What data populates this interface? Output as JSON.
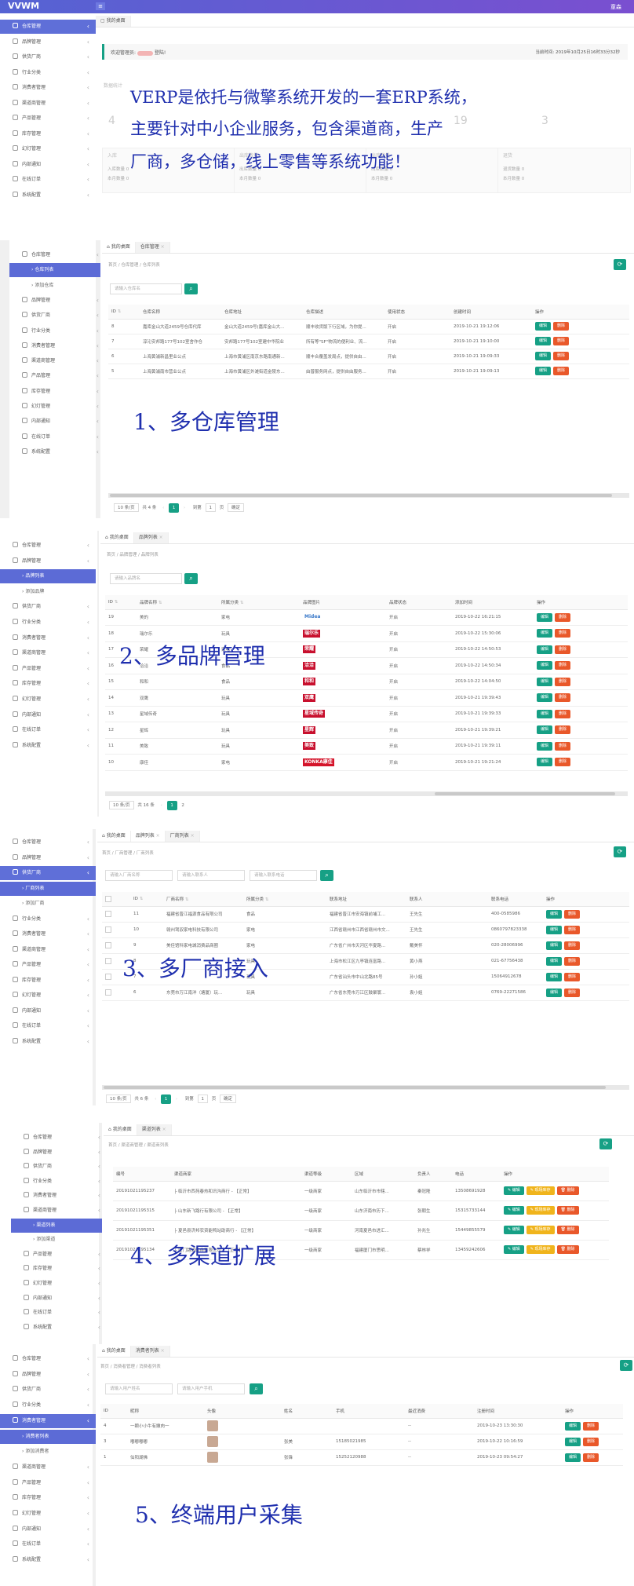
{
  "app": {
    "logo": "VVWM",
    "user": "童森"
  },
  "sidebar_icons": [
    "user-icon",
    "tag-icon",
    "factory-icon",
    "industry-icon",
    "consumer-icon",
    "channel-icon",
    "product-icon",
    "warehouse-icon",
    "slide-icon",
    "notice-icon",
    "order-icon",
    "gear-icon"
  ],
  "s1": {
    "sidebar": [
      "仓库管理",
      "品牌管理",
      "供货厂商",
      "行业分类",
      "消费者管理",
      "渠道商管理",
      "产品管理",
      "库存管理",
      "幻灯管理",
      "内部通知",
      "在线订单",
      "系统配置"
    ],
    "tab": "我的桌面",
    "welcome": "欢迎管理员: ",
    "welcome_suffix": " 登陆!",
    "time": "当前时间: 2019年10月25日16时33分32秒",
    "overlay": [
      "VERP是依托与微擎系统开发的一套ERP系统，",
      "主要针对中小企业服务，包含渠道商，生产",
      "厂商，多仓储，线上零售等系统功能！"
    ],
    "stat_numbers": [
      "4",
      "19",
      "3"
    ],
    "stat_label": "数据统计",
    "cards": [
      {
        "title": "入库",
        "lines": [
          "入库数量 0",
          "本月数量 0"
        ]
      },
      {
        "title": "出库数量",
        "lines": [
          "出库数量 0",
          "本月数量 0"
        ]
      },
      {
        "title": "出库数量",
        "lines": [
          "出库数量 0",
          "本月数量 0"
        ]
      },
      {
        "title": "退货",
        "lines": [
          "退货数量 0",
          "本月数量 0"
        ]
      }
    ]
  },
  "s2": {
    "sidebar": [
      "仓库管理",
      "仓库列表",
      "添加仓库",
      "品牌管理",
      "供货厂商",
      "行业分类",
      "消费者管理",
      "渠道商管理",
      "产品管理",
      "库存管理",
      "幻灯管理",
      "内部通知",
      "在线订单",
      "系统配置"
    ],
    "tabs": [
      "我的桌面",
      "仓库管理"
    ],
    "crumb": "首页  /  仓库管理  /  仓库列表",
    "search_placeholder": "请输入仓库名",
    "columns": [
      "ID",
      "仓库名称",
      "仓库地址",
      "仓库描述",
      "使用状态",
      "创建时间",
      "操作"
    ],
    "rows": [
      [
        "8",
        "嘉库金山大道2459号仓库代库",
        "金山大道2459号(嘉库金山大...",
        "顺丰收货版下行区域，为你提...",
        "开启",
        "2019-10-21 19:12:06"
      ],
      [
        "7",
        "淳沁安邦路177号102室舍作仓",
        "安邦路177号102室建中华院业",
        "所有等\"SF\"物流的便利业、流...",
        "开启",
        "2019-10-21 19:10:00"
      ],
      [
        "6",
        "上海黄浦新昌里业公点",
        "上海市黄浦区南京东路南通新...",
        "顺丰合覆盖发局点，提供自由...",
        "开启",
        "2019-10-21 19:09:33"
      ],
      [
        "5",
        "上海黄浦南市营业公点",
        "上海市黄浦区外滩街道金陵东...",
        "由普服务网点，提供自由服务...",
        "开启",
        "2019-10-21 19:09:13"
      ]
    ],
    "pager": {
      "size": "10 条/页",
      "total": "共 4 条",
      "page": "1",
      "goto": "到第",
      "page_input": "1",
      "unit": "页",
      "ok": "确定"
    },
    "overlay": "1、多仓库管理"
  },
  "s3": {
    "sidebar": [
      "仓库管理",
      "品牌管理",
      "品牌列表",
      "添加品牌",
      "供货厂商",
      "行业分类",
      "消费者管理",
      "渠道商管理",
      "产品管理",
      "库存管理",
      "幻灯管理",
      "内部通知",
      "在线订单",
      "系统配置"
    ],
    "tabs": [
      "我的桌面",
      "品牌列表"
    ],
    "crumb": "首页  /  品牌管理  /  品牌列表",
    "search_placeholder": "请输入品牌名",
    "columns": [
      "ID",
      "品牌名称",
      "所属分类",
      "品牌图片",
      "品牌状态",
      "添加时间",
      "操作"
    ],
    "rows": [
      [
        "19",
        "美的",
        "家电",
        "Midea",
        "开启",
        "2019-10-22 16:21:15"
      ],
      [
        "18",
        "瑞尔乐",
        "玩具",
        "瑞尔乐",
        "开启",
        "2019-10-22 15:30:06"
      ],
      [
        "17",
        "荣耀",
        "家电",
        "荣耀",
        "开启",
        "2019-10-22 14:50:53"
      ],
      [
        "16",
        "洽洽",
        "食品",
        "洽洽",
        "开启",
        "2019-10-22 14:50:34"
      ],
      [
        "15",
        "和和",
        "食品",
        "和和",
        "开启",
        "2019-10-22 14:04:50"
      ],
      [
        "14",
        "双鹰",
        "玩具",
        "双鹰",
        "开启",
        "2019-10-21 19:39:43"
      ],
      [
        "13",
        "星域传奇",
        "玩具",
        "星域传奇",
        "开启",
        "2019-10-21 19:39:33"
      ],
      [
        "12",
        "星辉",
        "玩具",
        "星辉",
        "开启",
        "2019-10-21 19:39:21"
      ],
      [
        "11",
        "美致",
        "玩具",
        "美致",
        "开启",
        "2019-10-21 19:39:11"
      ],
      [
        "10",
        "康佳",
        "家电",
        "KONKA康佳",
        "开启",
        "2019-10-21 19:21:24"
      ]
    ],
    "logo_colors": [
      "#3a79c9",
      "#c8102e",
      "#c8102e",
      "#c8102e",
      "#c8102e",
      "#c8102e",
      "#c8102e",
      "#c8102e",
      "#c8102e",
      "#d4142a"
    ],
    "pager": {
      "size": "10 条/页",
      "total": "共 16 条",
      "page": "1",
      "next": "2"
    },
    "overlay": "2、多品牌管理"
  },
  "s4": {
    "sidebar": [
      "仓库管理",
      "品牌管理",
      "供货厂商",
      "厂商列表",
      "添加厂商",
      "行业分类",
      "消费者管理",
      "渠道商管理",
      "产品管理",
      "库存管理",
      "幻灯管理",
      "内部通知",
      "在线订单",
      "系统配置"
    ],
    "tabs": [
      "我的桌面",
      "品牌列表",
      "厂商列表"
    ],
    "crumb": "首页  /  厂商管理  /  厂商列表",
    "search": [
      "请输入厂商名称",
      "请输入联系人",
      "请输入联系电话"
    ],
    "columns": [
      "",
      "ID",
      "厂商名称",
      "所属分类",
      "联系地址",
      "联系人",
      "联系电话",
      "操作"
    ],
    "rows": [
      [
        "",
        "11",
        "福建省晋江福源食品有限公司",
        "食品",
        "福建省晋江市安海镇前埔工...",
        "王先生",
        "400-0585986"
      ],
      [
        "",
        "10",
        "赣州驾驭家电科技有限公司",
        "家电",
        "江西省赣州市江西省赣州市文...",
        "王先生",
        "0860797823338"
      ],
      [
        "",
        "9",
        "美佳馆科家电城消费品商圈",
        "家电",
        "广东省广州市天河区华夏路...",
        "戴美怀",
        "020-28006996"
      ],
      [
        "",
        "8",
        "",
        "玩具",
        "上海市松江区九亭镇连富路...",
        "黄小燕",
        "021-67756438"
      ],
      [
        "",
        "7",
        "",
        "玩具",
        "广东省汕头市中山北路85号",
        "孙小姐",
        "15064912678"
      ],
      [
        "",
        "6",
        "东莞市万江南洋（塘厦）玩...",
        "玩具",
        "广东省东莞市万江区鼓聚寰...",
        "袁小姐",
        "0769-22271586"
      ]
    ],
    "pager": {
      "size": "10 条/页",
      "total": "共 6 条",
      "page": "1",
      "goto": "到第",
      "page_input": "1",
      "unit": "页",
      "ok": "确定"
    },
    "overlay": "3、多厂商接入"
  },
  "s5": {
    "sidebar": [
      "仓库管理",
      "品牌管理",
      "供货厂商",
      "行业分类",
      "消费者管理",
      "渠道商管理",
      "渠道列表",
      "添加渠道",
      "产品管理",
      "库存管理",
      "幻灯管理",
      "内部通知",
      "在线订单",
      "系统配置"
    ],
    "tabs": [
      "我的桌面",
      "渠道列表"
    ],
    "crumb": "首页  /  渠道商管理  /  渠道商列表",
    "columns": [
      "编号",
      "渠道商家",
      "渠道等级",
      "区域",
      "负责人",
      "电话",
      "操作"
    ],
    "rows": [
      [
        "20191021195237",
        "├ 临沂市西苑春热和讯沟商行 - 【正常】",
        "一级商家",
        "山东临沂市市辖...",
        "秦冠隆",
        "13508691928"
      ],
      [
        "20191021195315",
        "├ 山东新飞路行有限公司 - 【正常】",
        "一级商家",
        "山东济南市历下...",
        "张朝生",
        "15315733144"
      ],
      [
        "20191021195351",
        "├ 夏邑县济邦农资能鸭站助商行 - 【正常】",
        "一级商家",
        "河南夏邑市进汇...",
        "孙兆生",
        "15449855579"
      ],
      [
        "20191021195134",
        "├ 厦门路滤硅谷有限公司 - 【正常】",
        "一级商家",
        "福建厦门市思明...",
        "蔡林祥",
        "13459242606"
      ]
    ],
    "btn_edit": "✎ 编辑",
    "btn_stock": "✎ 现场库存",
    "btn_del": "🗑 删除",
    "overlay": "4、多渠道扩展"
  },
  "s6": {
    "sidebar": [
      "仓库管理",
      "品牌管理",
      "供货厂商",
      "行业分类",
      "消费者管理",
      "消费者列表",
      "添加消费者",
      "渠道商管理",
      "产品管理",
      "库存管理",
      "幻灯管理",
      "内部通知",
      "在线订单",
      "系统配置"
    ],
    "tabs": [
      "我的桌面",
      "消费者列表"
    ],
    "crumb": "首页  /  消费者管理  /  消费者列表",
    "search": [
      "请输入用户姓名",
      "请输入用户手机"
    ],
    "columns": [
      "ID",
      "昵称",
      "头像",
      "姓名",
      "手机",
      "最近消费",
      "注册时间",
      "操作"
    ],
    "rows": [
      [
        "4",
        "一颗小小牛有嫩肉一",
        "",
        "",
        "",
        "--",
        "2019-10-23 13:30:30"
      ],
      [
        "3",
        "嘟嘟嘟嘟",
        "",
        "张美",
        "15185021985",
        "--",
        "2019-10-22 10:16:59"
      ],
      [
        "1",
        "仙阳湖佛",
        "",
        "张锋",
        "15252120988",
        "--",
        "2019-10-23 09:54:27"
      ]
    ],
    "overlay": "5、终端用户采集"
  },
  "buttons": {
    "edit": "编辑",
    "del": "删除"
  }
}
